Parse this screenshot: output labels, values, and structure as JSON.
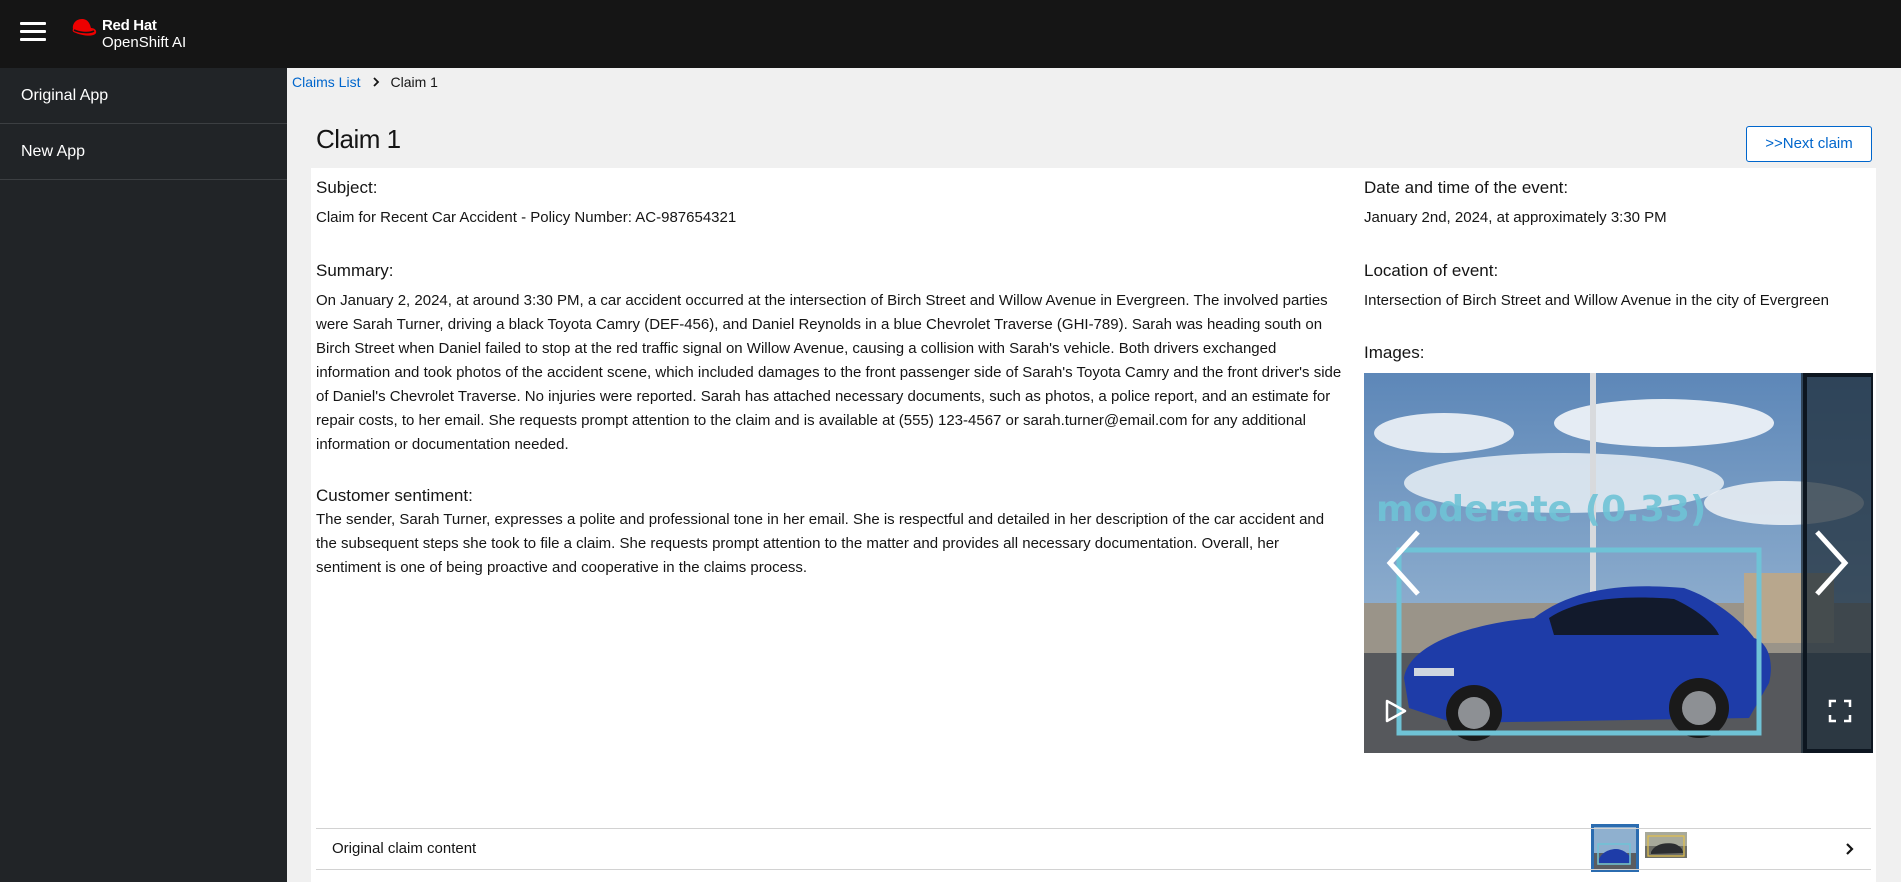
{
  "masthead": {
    "brand_line1": "Red Hat",
    "brand_line2": "OpenShift AI",
    "menu_icon": "hamburger-icon",
    "logo_icon": "red-hat-logo-icon",
    "brand_color": "#ee0000"
  },
  "sidebar": {
    "items": [
      {
        "label": "Original App"
      },
      {
        "label": "New App"
      }
    ]
  },
  "breadcrumb": {
    "parent": "Claims List",
    "current": "Claim 1",
    "separator_icon": "chevron-right-icon"
  },
  "page": {
    "title": "Claim 1",
    "next_button": ">>Next claim"
  },
  "claim": {
    "subject_label": "Subject:",
    "subject": "Claim for Recent Car Accident - Policy Number: AC-987654321",
    "summary_label": "Summary:",
    "summary": "On January 2, 2024, at around 3:30 PM, a car accident occurred at the intersection of Birch Street and Willow Avenue in Evergreen. The involved parties were Sarah Turner, driving a black Toyota Camry (DEF-456), and Daniel Reynolds in a blue Chevrolet Traverse (GHI-789). Sarah was heading south on Birch Street when Daniel failed to stop at the red traffic signal on Willow Avenue, causing a collision with Sarah's vehicle. Both drivers exchanged information and took photos of the accident scene, which included damages to the front passenger side of Sarah's Toyota Camry and the front driver's side of Daniel's Chevrolet Traverse. No injuries were reported. Sarah has attached necessary documents, such as photos, a police report, and an estimate for repair costs, to her email. She requests prompt attention to the claim and is available at (555) 123-4567 or sarah.turner@email.com for any additional information or documentation needed.",
    "sentiment_label": "Customer sentiment:",
    "sentiment": "The sender, Sarah Turner, expresses a polite and professional tone in her email. She is respectful and detailed in her description of the car accident and the subsequent steps she took to file a claim. She requests prompt attention to the matter and provides all necessary documentation. Overall, her sentiment is one of being proactive and cooperative in the claims process.",
    "date_label": "Date and time of the event:",
    "date": "January 2nd, 2024, at approximately 3:30 PM",
    "location_label": "Location of event:",
    "location": "Intersection of Birch Street and Willow Avenue in the city of Evergreen",
    "images_label": "Images:"
  },
  "gallery": {
    "detection_label": "moderate (0.33)",
    "prev_icon": "chevron-left-icon",
    "next_icon": "chevron-right-icon",
    "play_icon": "play-icon",
    "fullscreen_icon": "fullscreen-icon",
    "active_index": 0,
    "thumbnail_count": 2,
    "detection_color": "#6fc3d6"
  },
  "accordion": {
    "label": "Original claim content",
    "chevron_icon": "chevron-right-icon"
  }
}
